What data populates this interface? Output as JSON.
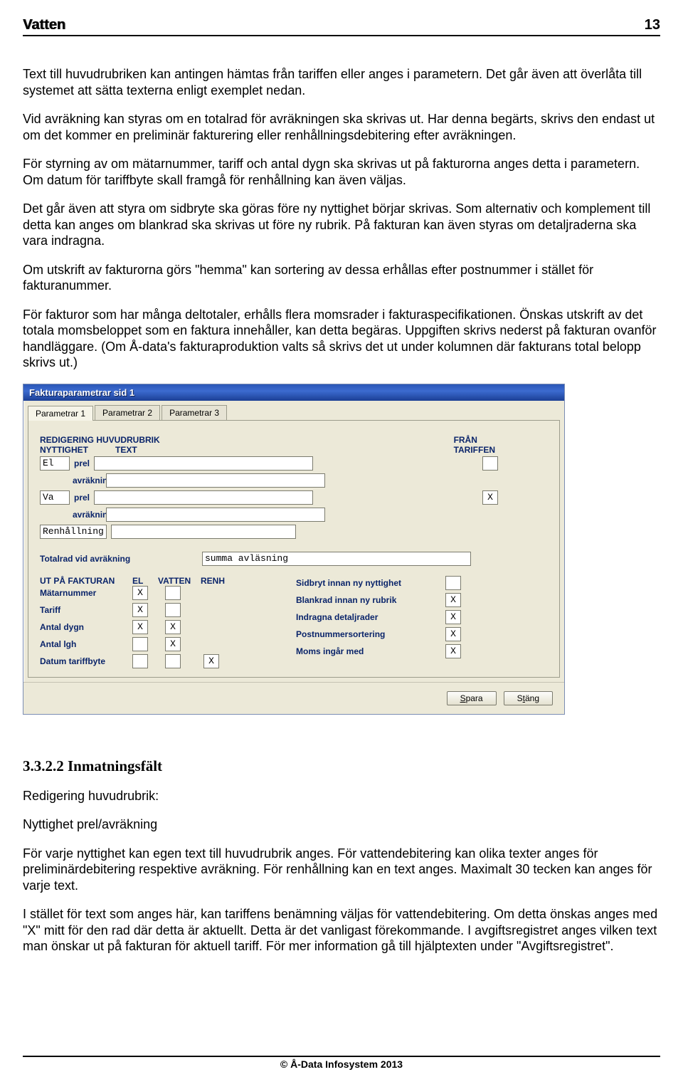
{
  "header": {
    "title": "Vatten",
    "pageNumber": "13"
  },
  "paragraphs": {
    "p1": "Text till huvudrubriken kan antingen hämtas från tariffen eller anges i parametern. Det går även att överlåta till systemet att sätta texterna enligt exemplet nedan.",
    "p2": "Vid avräkning kan styras om en totalrad för avräkningen ska skrivas ut. Har denna begärts, skrivs den endast ut om det kommer en preliminär fakturering eller renhållningsdebitering efter avräkningen.",
    "p3": "För styrning av om mätarnummer, tariff och antal dygn ska skrivas ut på fakturorna anges detta i parametern. Om datum för tariffbyte skall framgå för renhållning kan även väljas.",
    "p4": "Det går även att styra om sidbryte ska göras före ny nyttighet börjar skrivas. Som alternativ och komplement till detta kan anges om blankrad ska skrivas ut före ny rubrik. På fakturan kan även styras om detaljraderna ska vara indragna.",
    "p5": "Om utskrift av fakturorna görs \"hemma\" kan sortering av dessa erhållas efter postnummer i stället för fakturanummer.",
    "p6": "För fakturor som har många deltotaler, erhålls flera momsrader i fakturaspecifikationen. Önskas utskrift av det totala momsbeloppet som en faktura innehåller, kan detta begäras. Uppgiften skrivs nederst på fakturan ovanför handläggare. (Om Å-data's fakturaproduktion valts så skrivs det ut under kolumnen där fakturans total belopp skrivs ut.)"
  },
  "dialog": {
    "title": "Fakturaparametrar sid 1",
    "tabs": [
      "Parametrar 1",
      "Parametrar 2",
      "Parametrar 3"
    ],
    "headingHuvud": "REDIGERING HUVUDRUBRIK",
    "colNyttighet": "NYTTIGHET",
    "colText": "TEXT",
    "colFran": "FRÅN",
    "colTariffen": "TARIFFEN",
    "rows": [
      {
        "nytt": "El",
        "text1": "prel",
        "text2": "avräkning",
        "fran": ""
      },
      {
        "nytt": "Va",
        "text1": "prel",
        "text2": "avräkning",
        "fran": "X"
      },
      {
        "nytt": "Renhållning",
        "text1": "",
        "text2": "",
        "fran": ""
      }
    ],
    "totalLabel": "Totalrad vid avräkning",
    "totalValue": "summa avläsning",
    "utPaFakturan": "UT PÅ FAKTURAN",
    "colEl": "EL",
    "colVatten": "VATTEN",
    "colRenh": "RENH",
    "lowerLeft": [
      {
        "label": "Mätarnummer",
        "el": "X",
        "vatten": "",
        "renh": ""
      },
      {
        "label": "Tariff",
        "el": "X",
        "vatten": "",
        "renh": ""
      },
      {
        "label": "Antal dygn",
        "el": "X",
        "vatten": "X",
        "renh": ""
      },
      {
        "label": "Antal lgh",
        "el": "",
        "vatten": "X",
        "renh": ""
      },
      {
        "label": "Datum tariffbyte",
        "el": "",
        "vatten": "",
        "renh": "X"
      }
    ],
    "lowerRight": [
      {
        "label": "Sidbryt innan ny nyttighet",
        "val": ""
      },
      {
        "label": "Blankrad innan ny rubrik",
        "val": "X"
      },
      {
        "label": "Indragna detaljrader",
        "val": "X"
      },
      {
        "label": "Postnummersortering",
        "val": "X"
      },
      {
        "label": "Moms ingår med",
        "val": "X"
      }
    ],
    "btnSave": "Spara",
    "btnClose": "Stäng"
  },
  "section2": {
    "heading": "3.3.2.2 Inmatningsfält",
    "sub1": "Redigering huvudrubrik:",
    "sub2": "Nyttighet prel/avräkning",
    "p1": "För varje nyttighet kan egen text till huvudrubrik anges. För vattendebitering kan olika texter anges för preliminärdebitering respektive avräkning. För renhållning kan en text anges. Maximalt 30 tecken kan anges för varje text.",
    "p2": "I stället för text som anges här, kan tariffens benämning väljas för vattendebitering. Om detta önskas anges med \"X\" mitt för den rad där detta är aktuellt. Detta är det vanligast förekommande. I avgiftsregistret anges vilken text man önskar ut på fakturan för aktuell tariff. För mer information gå till hjälptexten under \"Avgiftsregistret\"."
  },
  "footer": "© Å-Data Infosystem 2013"
}
